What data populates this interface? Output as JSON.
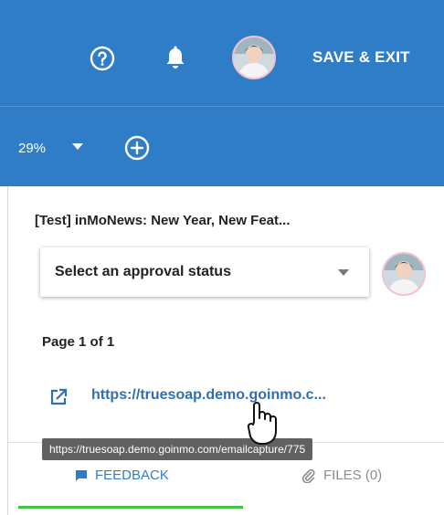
{
  "header": {
    "save_exit_label": "SAVE & EXIT",
    "zoom_value": "29%",
    "icons": [
      "help-icon",
      "bell-icon",
      "avatar",
      "chevron-down-icon",
      "add-circle-icon"
    ],
    "background_color": "#2e7dc6"
  },
  "panel": {
    "doc_title": "[Test] inMoNews: New Year, New Feat...",
    "approval_select": {
      "selected": "Select an approval status"
    },
    "page_label": "Page 1 of 1",
    "link_text": "https://truesoap.demo.goinmo.c...",
    "link_icon": "open-in-new-icon",
    "tooltip": "https://truesoap.demo.goinmo.com/emailcapture/775"
  },
  "tabs": [
    {
      "label": "FEEDBACK",
      "icon": "comment-icon",
      "active": true
    },
    {
      "label": "FILES (0)",
      "icon": "paperclip-icon",
      "active": false
    }
  ],
  "colors": {
    "accent": "#2e7dc6",
    "link": "#2e6fb0",
    "active_indicator": "#42c343"
  }
}
